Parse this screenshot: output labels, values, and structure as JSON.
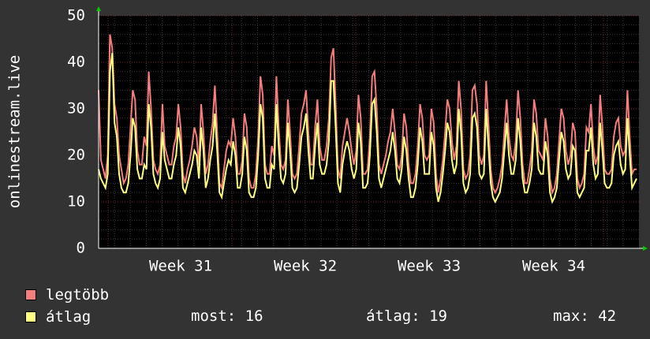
{
  "chart_data": {
    "type": "line",
    "ylabel": "onlinestream.live",
    "ylim": [
      0,
      50
    ],
    "yticks": [
      0,
      10,
      20,
      30,
      40,
      50
    ],
    "x_labels": [
      "Week 31",
      "Week 32",
      "Week 33",
      "Week 34"
    ],
    "grid": true,
    "legend_position": "bottom-left",
    "series": [
      {
        "name": "legtöbb",
        "color": "#f47d7d",
        "values": [
          34,
          19,
          17,
          15,
          20,
          46,
          43,
          31,
          28,
          20,
          17,
          14,
          15,
          18,
          26,
          34,
          32,
          21,
          18,
          18,
          24,
          22,
          38,
          30,
          19,
          17,
          16,
          18,
          31,
          22,
          20,
          18,
          18,
          22,
          24,
          31,
          26,
          16,
          14,
          17,
          19,
          22,
          26,
          24,
          18,
          31,
          25,
          16,
          18,
          23,
          27,
          35,
          25,
          14,
          13,
          17,
          21,
          23,
          22,
          28,
          24,
          16,
          16,
          19,
          29,
          26,
          15,
          13,
          13,
          16,
          24,
          37,
          33,
          18,
          16,
          16,
          22,
          20,
          37,
          26,
          18,
          17,
          19,
          32,
          25,
          16,
          15,
          16,
          22,
          29,
          31,
          34,
          25,
          18,
          18,
          26,
          32,
          22,
          19,
          19,
          22,
          28,
          41,
          43,
          31,
          17,
          15,
          22,
          25,
          28,
          25,
          21,
          18,
          21,
          33,
          28,
          16,
          16,
          17,
          24,
          37,
          38,
          30,
          18,
          16,
          18,
          20,
          23,
          25,
          30,
          25,
          18,
          17,
          20,
          29,
          26,
          18,
          14,
          14,
          16,
          22,
          31,
          28,
          20,
          19,
          20,
          30,
          27,
          16,
          12,
          15,
          19,
          25,
          32,
          30,
          23,
          19,
          22,
          36,
          30,
          17,
          15,
          16,
          20,
          34,
          35,
          31,
          20,
          18,
          20,
          36,
          27,
          17,
          13,
          12,
          13,
          15,
          18,
          25,
          32,
          24,
          20,
          19,
          23,
          34,
          28,
          18,
          14,
          14,
          17,
          21,
          32,
          29,
          21,
          20,
          19,
          28,
          24,
          15,
          12,
          13,
          16,
          23,
          30,
          28,
          21,
          18,
          20,
          27,
          25,
          15,
          13,
          14,
          16,
          26,
          25,
          31,
          22,
          18,
          20,
          33,
          26,
          17,
          16,
          16,
          17,
          24,
          27,
          28,
          22,
          20,
          21,
          34,
          24,
          16,
          17,
          17
        ]
      },
      {
        "name": "átlag",
        "color": "#ffff80",
        "values": [
          17,
          15,
          14,
          13,
          16,
          38,
          42,
          27,
          24,
          16,
          13,
          12,
          12,
          14,
          20,
          28,
          26,
          17,
          15,
          15,
          18,
          17,
          31,
          26,
          16,
          14,
          13,
          15,
          25,
          19,
          17,
          15,
          15,
          18,
          20,
          26,
          22,
          13,
          12,
          14,
          16,
          18,
          21,
          20,
          15,
          26,
          21,
          13,
          15,
          19,
          22,
          29,
          21,
          12,
          11,
          14,
          17,
          19,
          18,
          23,
          20,
          13,
          13,
          16,
          24,
          21,
          12,
          11,
          11,
          13,
          20,
          31,
          28,
          15,
          13,
          13,
          18,
          17,
          31,
          22,
          15,
          14,
          16,
          27,
          21,
          13,
          12,
          13,
          18,
          24,
          26,
          29,
          21,
          15,
          15,
          22,
          27,
          18,
          16,
          16,
          18,
          23,
          36,
          36,
          26,
          14,
          12,
          18,
          21,
          23,
          21,
          17,
          15,
          17,
          27,
          23,
          13,
          13,
          14,
          20,
          31,
          32,
          25,
          15,
          13,
          15,
          17,
          19,
          21,
          25,
          21,
          15,
          14,
          17,
          24,
          21,
          15,
          11,
          11,
          13,
          18,
          26,
          23,
          16,
          16,
          16,
          25,
          22,
          13,
          10,
          12,
          16,
          21,
          27,
          25,
          19,
          16,
          18,
          30,
          25,
          14,
          12,
          13,
          16,
          28,
          29,
          26,
          16,
          15,
          16,
          30,
          22,
          14,
          11,
          10,
          11,
          12,
          15,
          21,
          27,
          20,
          16,
          16,
          19,
          28,
          23,
          15,
          12,
          12,
          14,
          17,
          27,
          24,
          17,
          16,
          16,
          23,
          20,
          12,
          10,
          11,
          13,
          19,
          25,
          23,
          17,
          15,
          16,
          22,
          21,
          12,
          11,
          12,
          13,
          21,
          21,
          26,
          18,
          15,
          16,
          27,
          21,
          14,
          13,
          13,
          14,
          20,
          22,
          23,
          18,
          16,
          17,
          28,
          20,
          13,
          14,
          15
        ]
      }
    ]
  },
  "legend": {
    "items": [
      {
        "label": "legtöbb",
        "color": "#f47d7d"
      },
      {
        "label": "átlag",
        "color": "#ffff80"
      }
    ]
  },
  "stats": {
    "current": "most: 16",
    "average": "átlag: 19",
    "max": "max: 42"
  },
  "colors": {
    "background": "#333333",
    "plot_background": "#000000",
    "grid_minor": "#3a3a3a",
    "grid_major": "#6e2a2a",
    "text": "#ffffff",
    "axis_arrow": "#00cc00"
  }
}
